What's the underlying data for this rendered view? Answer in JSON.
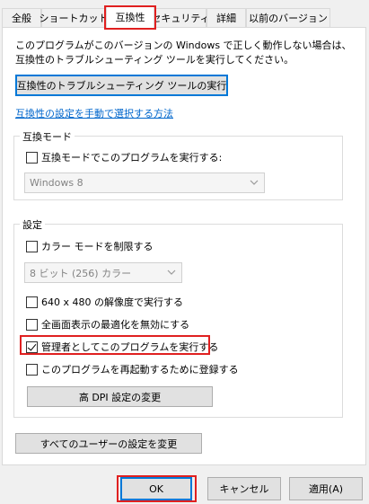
{
  "tabs": [
    {
      "label": "全般"
    },
    {
      "label": "ショートカット"
    },
    {
      "label": "互換性"
    },
    {
      "label": "セキュリティ"
    },
    {
      "label": "詳細"
    },
    {
      "label": "以前のバージョン"
    }
  ],
  "description": "このプログラムがこのバージョンの Windows で正しく動作しない場合は、互換性のトラブルシューティング ツールを実行してください。",
  "troubleshooter_button": "互換性のトラブルシューティング ツールの実行",
  "manual_link": "互換性の設定を手動で選択する方法",
  "compat_mode": {
    "title": "互換モード",
    "checkbox_label": "互換モードでこのプログラムを実行する:",
    "checked": false,
    "select_value": "Windows 8"
  },
  "settings": {
    "title": "設定",
    "color_mode_label": "カラー モードを制限する",
    "color_mode_checked": false,
    "color_select_value": "8 ビット (256) カラー",
    "res_label": "640 x 480 の解像度で実行する",
    "res_checked": false,
    "fullscreen_label": "全画面表示の最適化を無効にする",
    "fullscreen_checked": false,
    "admin_label": "管理者としてこのプログラムを実行する",
    "admin_checked": true,
    "restart_label": "このプログラムを再起動するために登録する",
    "restart_checked": false,
    "dpi_button": "高 DPI 設定の変更"
  },
  "all_users_button": "すべてのユーザーの設定を変更",
  "footer": {
    "ok": "OK",
    "cancel": "キャンセル",
    "apply": "適用(A)"
  },
  "highlight_color": "#e02020",
  "link_color": "#0066cc"
}
